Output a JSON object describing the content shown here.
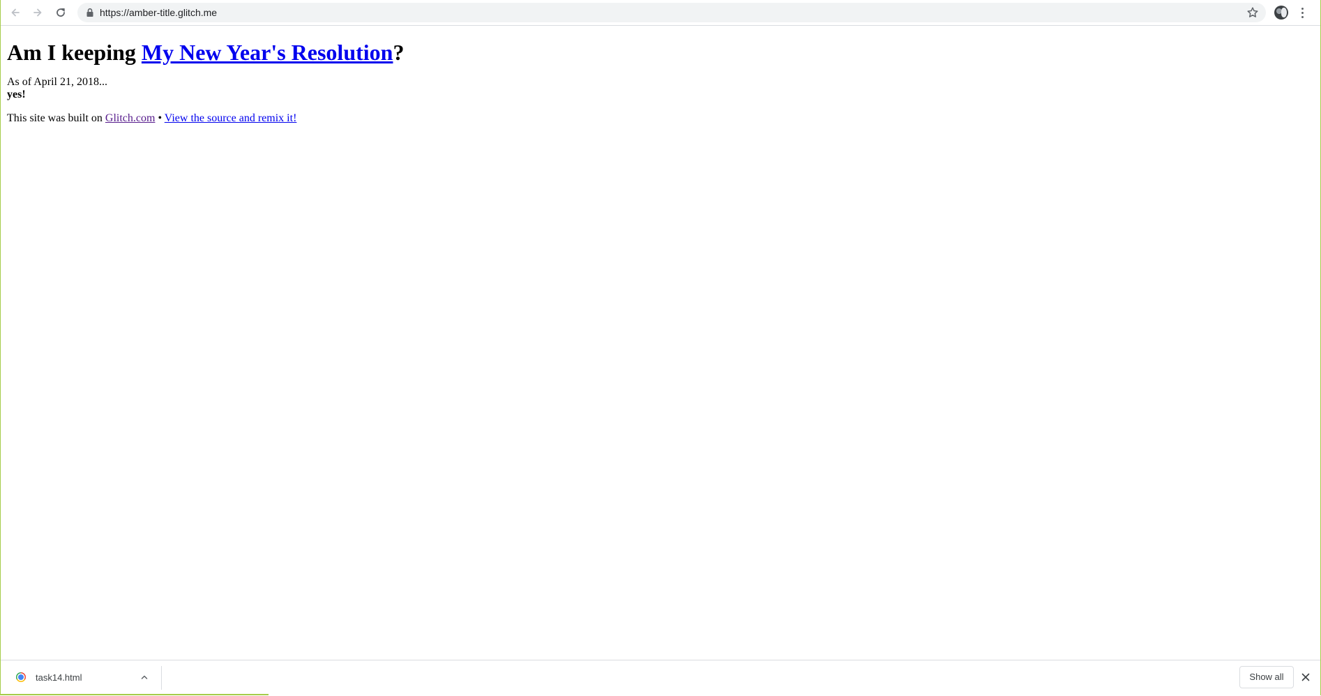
{
  "browser": {
    "url": "https://amber-title.glitch.me",
    "accent_color": "#a5cc4a",
    "icons": {
      "back": "back-arrow-icon",
      "forward": "forward-arrow-icon",
      "reload": "reload-icon",
      "secure": "lock-icon",
      "bookmark": "star-icon",
      "profile": "avatar",
      "menu": "kebab-menu-icon"
    }
  },
  "page": {
    "heading_prefix": "Am I keeping ",
    "heading_link": "My New Year's Resolution",
    "heading_suffix": "?",
    "as_of": "As of April 21, 2018...",
    "answer": "yes!",
    "footer_prefix": "This site was built on ",
    "footer_link_glitch": "Glitch.com",
    "footer_separator": " • ",
    "footer_link_remix": "View the source and remix it!",
    "link_color": "#0000ee",
    "visited_link_color": "#551a8b"
  },
  "downloads": {
    "file_name": "task14.html",
    "show_all_label": "Show all",
    "icons": {
      "file": "chrome-icon",
      "expand": "chevron-up-icon",
      "close": "close-icon"
    }
  }
}
